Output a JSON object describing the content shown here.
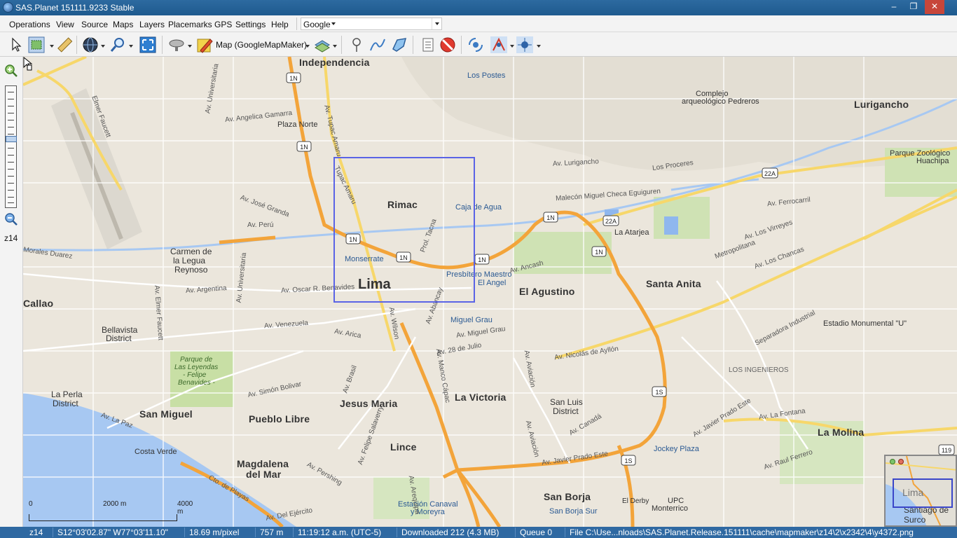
{
  "window": {
    "title": "SAS.Planet 151111.9233 Stable",
    "minimize_glyph": "–",
    "maximize_glyph": "❐",
    "close_glyph": "✕"
  },
  "menu": {
    "items": [
      "Operations",
      "View",
      "Source",
      "Maps",
      "Layers",
      "Placemarks",
      "GPS",
      "Settings",
      "Help"
    ],
    "source_combo_value": "Google"
  },
  "toolbar": {
    "map_type_label": "Map (GoogleMapMaker)"
  },
  "zoom_panel": {
    "zoom_label": "z14"
  },
  "map": {
    "labels": {
      "independencia": "Independencia",
      "los_postes": "Los Postes",
      "complejo": "Complejo",
      "arqueologico": "arqueológico Pedreros",
      "lurigancho": "Lurigancho",
      "parque_zoo": "Parque Zoológico",
      "huachipa": "Huachipa",
      "plaza_norte": "Plaza Norte",
      "av_angelica": "Av. Angelica Gamarra",
      "rimac": "Rimac",
      "caja_de_agua": "Caja de Agua",
      "los_proceres": "Los Proceres",
      "malecon": "Malecón Miguel Checa Eguiguren",
      "av_ferrocarril_1": "Av. Ferrocarril",
      "la_atarjea": "La Atarjea",
      "av_lurigancho": "Av. Lurigancho",
      "carmen_1": "Carmen de",
      "carmen_2": "la Legua",
      "carmen_3": "Reynoso",
      "morales": "Morales Duarez",
      "monserrate": "Monserrate",
      "lima": "Lima",
      "presbitero": "Presbítero Maestro",
      "el_angel": "El Angel",
      "el_agustino": "El Agustino",
      "santa_anita": "Santa Anita",
      "callao": "Callao",
      "av_argentina": "Av. Argentina",
      "av_oscar": "Av. Oscar R. Benavides",
      "av_peru": "Av. Perú",
      "av_jose_granda": "Av. José Granda",
      "miguel_grau": "Miguel Grau",
      "av_miguel_grau": "Av. Miguel Grau",
      "estadio": "Estadio Monumental \"U\"",
      "bellavista_1": "Bellavista",
      "bellavista_2": "District",
      "parque_1": "Parque de",
      "parque_2": "Las Leyendas",
      "parque_3": "- Felipe",
      "parque_4": "Benavides -",
      "av_venezuela": "Av. Venezuela",
      "av_arica": "Av. Arica",
      "av_28": "Av. 28 de Julio",
      "av_nicolas": "Av. Nicolás de Ayllón",
      "los_ingenieros": "LOS INGENIEROS",
      "la_perla_1": "La Perla",
      "la_perla_2": "District",
      "jesus_maria": "Jesus Maria",
      "la_victoria": "La Victoria",
      "san_luis_1": "San Luis",
      "san_luis_2": "District",
      "san_miguel": "San Miguel",
      "pueblo_libre": "Pueblo Libre",
      "lince": "Lince",
      "la_molina": "La Molina",
      "av_javier_prado": "Av. Javier Prado Este",
      "jockey": "Jockey Plaza",
      "costa_verde": "Costa Verde",
      "magdalena_1": "Magdalena",
      "magdalena_2": "del Mar",
      "san_borja": "San Borja",
      "estacion_1": "Estación Canaval",
      "estacion_2": "y Moreyra",
      "san_borja_sur": "San Borja Sur",
      "upc_1": "UPC",
      "upc_2": "Monterrico",
      "av_faucett": "Av. Elmer Faucett",
      "elmer_faucett": "Elmer Faucett",
      "av_universitaria": "Av. Universitaria",
      "tupac_amaru": "Av. Tupac Amaru",
      "tupac_amaru_2": "Tupac Amaru",
      "prol_tacna": "Prol. Tacna",
      "av_abancay": "Av. Abancay",
      "av_wilson": "Av. Wilson",
      "av_brasil": "Av. Brasil",
      "av_manco": "Av. Manco Cápac",
      "av_ancash": "Av. Ancash",
      "av_los_chancas": "Av. Los Chancas",
      "av_los_virreyes": "Av. Los Virreyes",
      "metropolitana": "Metropolitana",
      "separadora": "Separadora Industrial",
      "av_la_fontana": "Av. La Fontana",
      "av_raul_ferrero": "Av. Raul Ferrero",
      "av_canada": "Av. Canadá",
      "cto_playas": "Cto. de Playas",
      "av_del_ejercito": "Av. Del Ejército",
      "av_la_paz": "Av. La Paz",
      "av_simon": "Av. Simón Bolivar",
      "av_pershing": "Av. Pershing",
      "el_derby": "El Derby",
      "santiago_1": "Santiago",
      "santiago_2": "de Surco",
      "av_salaverry": "Av. Felipe Salaverry",
      "av_arequipa": "Av. Arequipa",
      "av_aviacion": "Av. Aviación",
      "av_lurigancho_2": "Av. Lurigancho",
      "s1n_1": "1N",
      "s1n_2": "1N",
      "s1n_3": "1N",
      "s1n_4": "1N",
      "s1n_5": "1N",
      "s1n_6": "1N",
      "s1n_7": "1N",
      "s22a_1": "22A",
      "s22a_2": "22A",
      "s1s_1": "1S",
      "s1s_2": "1S",
      "s119": "119"
    },
    "scale_bar": {
      "left": "0",
      "mid": "2000 m",
      "right": "4000 m"
    },
    "minimap": {
      "label": "Lima",
      "label2": "Santiago de Surco"
    },
    "colors": {
      "highway": "#f3a43a",
      "arterial": "#f7d76a",
      "sea": "#a7c8f2",
      "park": "#c8dfa5",
      "land": "#ebe6dc",
      "selection": "#5a63e6"
    }
  },
  "status": {
    "zoom": "z14",
    "coords": "S12°03'02.87\" W77°03'11.10\"",
    "resolution": "18.69 m/pixel",
    "distance": "757 m",
    "time": "11:19:12 a.m. (UTC-5)",
    "downloaded": "Downloaded 212 (4.3 MB)",
    "queue": "Queue 0",
    "file": "File C:\\Use...nloads\\SAS.Planet.Release.151111\\cache\\mapmaker\\z14\\2\\x2342\\4\\y4372.png"
  }
}
